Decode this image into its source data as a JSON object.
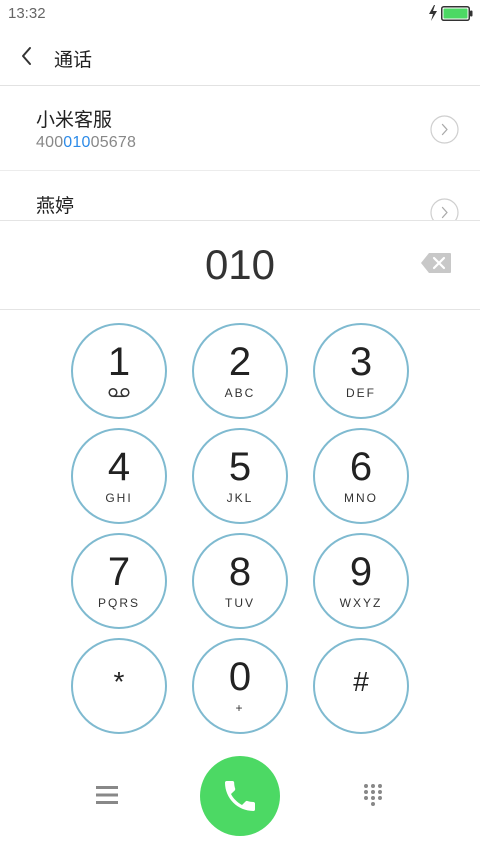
{
  "status_bar": {
    "time": "13:32"
  },
  "header": {
    "title": "通话"
  },
  "contacts": [
    {
      "name": "小米客服",
      "number_before": "400",
      "number_match": "010",
      "number_after": "05678"
    },
    {
      "name": "燕婷"
    }
  ],
  "dialer": {
    "number": "010",
    "keys": [
      {
        "digit": "1",
        "letters": ""
      },
      {
        "digit": "2",
        "letters": "ABC"
      },
      {
        "digit": "3",
        "letters": "DEF"
      },
      {
        "digit": "4",
        "letters": "GHI"
      },
      {
        "digit": "5",
        "letters": "JKL"
      },
      {
        "digit": "6",
        "letters": "MNO"
      },
      {
        "digit": "7",
        "letters": "PQRS"
      },
      {
        "digit": "8",
        "letters": "TUV"
      },
      {
        "digit": "9",
        "letters": "WXYZ"
      },
      {
        "digit": "*",
        "letters": ""
      },
      {
        "digit": "0",
        "letters": "+"
      },
      {
        "digit": "#",
        "letters": ""
      }
    ]
  },
  "colors": {
    "accent": "#2d8be8",
    "call": "#4cd964",
    "key_border": "#7fbad0",
    "battery": "#4cd964"
  },
  "icons": [
    "bolt-icon",
    "battery-icon",
    "back-icon",
    "chevron-right-icon",
    "backspace-icon",
    "voicemail-icon",
    "menu-icon",
    "phone-icon",
    "keypad-icon"
  ]
}
